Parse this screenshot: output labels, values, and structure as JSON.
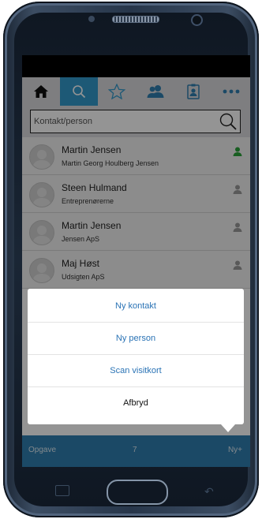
{
  "search": {
    "placeholder": "Kontakt/person"
  },
  "tabs": [
    {
      "icon": "home-icon"
    },
    {
      "icon": "search-icon",
      "active": true
    },
    {
      "icon": "star-icon"
    },
    {
      "icon": "users-icon"
    },
    {
      "icon": "contact-card-icon"
    },
    {
      "icon": "more-icon"
    }
  ],
  "contacts": [
    {
      "name": "Martin Jensen",
      "sub": "Martin Georg Houlberg Jensen",
      "status_color": "#2aa33a"
    },
    {
      "name": "Steen Hulmand",
      "sub": "Entreprenørerne",
      "status_color": "#9a9a9a"
    },
    {
      "name": "Martin Jensen",
      "sub": "Jensen ApS",
      "status_color": "#9a9a9a"
    },
    {
      "name": "Maj Høst",
      "sub": "Udsigten ApS",
      "status_color": "#9a9a9a"
    }
  ],
  "action_sheet": {
    "items": [
      "Ny kontakt",
      "Ny person",
      "Scan visitkort"
    ],
    "cancel": "Afbryd"
  },
  "bottom_bar": {
    "left": "Opgave",
    "count": "7",
    "right": "Ny+"
  },
  "colors": {
    "accent": "#3399cc",
    "bottom_bar": "#2f7fb0",
    "link": "#2a73b5"
  }
}
